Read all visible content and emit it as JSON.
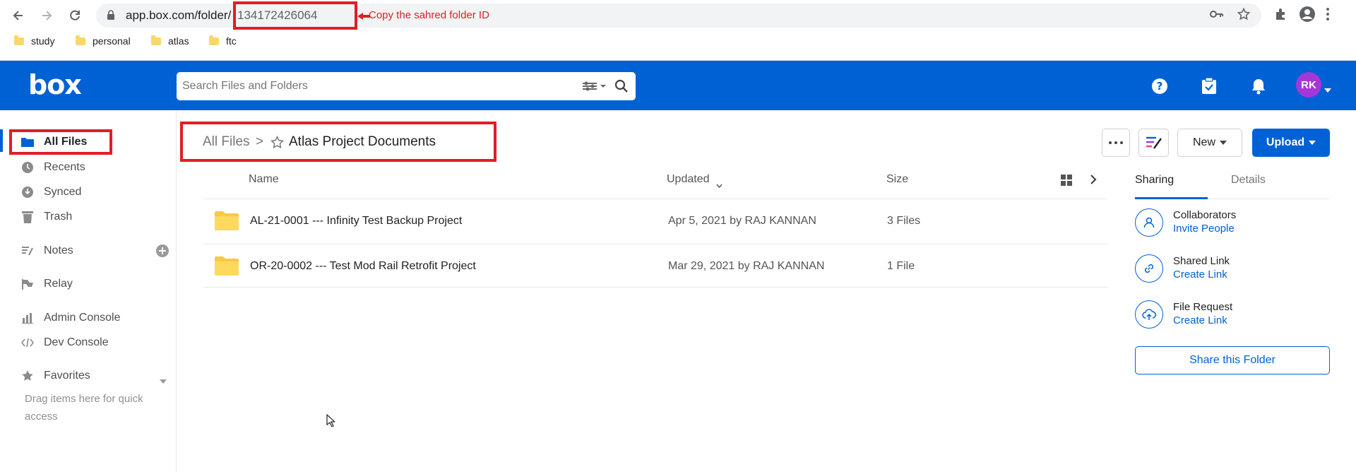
{
  "browser": {
    "url_prefix": "app.box.com/folder/",
    "folder_id": "134172426064",
    "annotation": "Copy the sahred folder ID",
    "bookmarks": [
      {
        "label": "study"
      },
      {
        "label": "personal"
      },
      {
        "label": "atlas"
      },
      {
        "label": "ftc"
      }
    ]
  },
  "header": {
    "logo": "box",
    "search_placeholder": "Search Files and Folders",
    "avatar_initials": "RK"
  },
  "sidebar": {
    "items": [
      {
        "label": "All Files",
        "icon": "folder-icon"
      },
      {
        "label": "Recents",
        "icon": "clock-icon"
      },
      {
        "label": "Synced",
        "icon": "sync-icon"
      },
      {
        "label": "Trash",
        "icon": "trash-icon"
      },
      {
        "label": "Notes",
        "icon": "notes-icon"
      },
      {
        "label": "Relay",
        "icon": "relay-icon"
      },
      {
        "label": "Admin Console",
        "icon": "bar-chart-icon"
      },
      {
        "label": "Dev Console",
        "icon": "code-icon"
      },
      {
        "label": "Favorites",
        "icon": "star-icon"
      }
    ],
    "quick_access_hint": "Drag items here for quick access"
  },
  "breadcrumb": {
    "root": "All Files",
    "separator": ">",
    "current": "Atlas Project Documents"
  },
  "toolbar": {
    "new_label": "New",
    "upload_label": "Upload"
  },
  "table": {
    "columns": {
      "name": "Name",
      "updated": "Updated",
      "size": "Size"
    },
    "rows": [
      {
        "name": "AL-21-0001 --- Infinity Test Backup Project",
        "updated": "Apr 5, 2021 by RAJ KANNAN",
        "size": "3 Files"
      },
      {
        "name": "OR-20-0002 --- Test Mod Rail Retrofit Project",
        "updated": "Mar 29, 2021 by RAJ KANNAN",
        "size": "1 File"
      }
    ]
  },
  "right_panel": {
    "tabs": {
      "sharing": "Sharing",
      "details": "Details"
    },
    "collaborators": {
      "title": "Collaborators",
      "link": "Invite People"
    },
    "shared_link": {
      "title": "Shared Link",
      "link": "Create Link"
    },
    "file_request": {
      "title": "File Request",
      "link": "Create Link"
    },
    "share_button": "Share this Folder"
  },
  "colors": {
    "brand": "#0061d5",
    "annotation_red": "#e01e26",
    "folder_yellow": "#ffd95e"
  }
}
